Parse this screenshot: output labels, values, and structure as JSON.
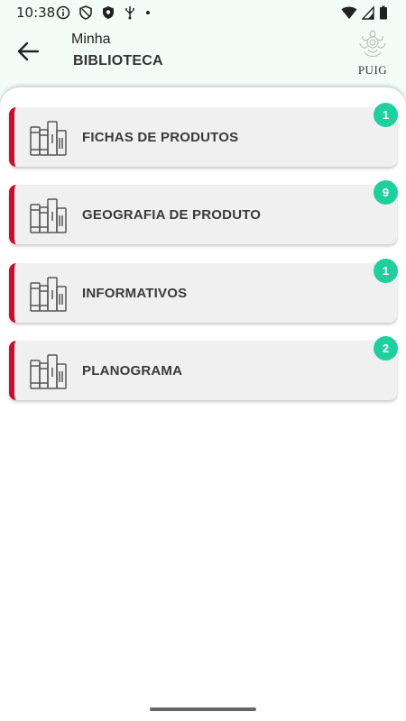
{
  "status_bar": {
    "time": "10:38",
    "left_icons": [
      "info-icon",
      "shield-icon",
      "shield-check-icon",
      "usb-icon",
      "dot-icon"
    ],
    "right_icons": [
      "wifi-icon",
      "cellular-signal-icon",
      "battery-icon"
    ]
  },
  "header": {
    "title_line1": "Minha",
    "title_line2": "BIBLIOTECA",
    "logo_text": "PUIG"
  },
  "colors": {
    "accent_border": "#c8102e",
    "badge": "#1fcf9e",
    "header_bg": "#f2fdf7",
    "card_bg": "#f0f0f0"
  },
  "categories": [
    {
      "label": "FICHAS DE PRODUTOS",
      "count": "1",
      "icon": "books-icon"
    },
    {
      "label": "GEOGRAFIA DE PRODUTO",
      "count": "9",
      "icon": "books-icon"
    },
    {
      "label": "INFORMATIVOS",
      "count": "1",
      "icon": "books-icon"
    },
    {
      "label": "PLANOGRAMA",
      "count": "2",
      "icon": "books-icon"
    }
  ]
}
